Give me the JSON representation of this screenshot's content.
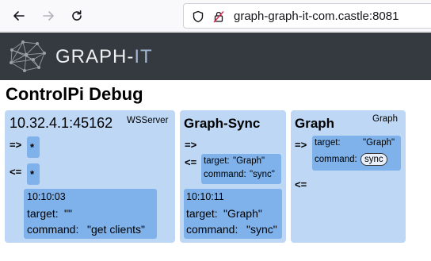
{
  "browser": {
    "url": "graph-graph-it-com.castle:8081"
  },
  "app": {
    "brand_main": "GRAPH-",
    "brand_accent": "IT"
  },
  "page": {
    "title": "ControlPi Debug"
  },
  "cards": [
    {
      "name": "10.32.4.1:45162",
      "type": "WSServer",
      "out_arrow": "=>",
      "in_arrow": "<=",
      "out_message": "*",
      "in_message": "*",
      "last_message": {
        "time": "10:10:03",
        "target_label": "target:",
        "target_value": "\"\"",
        "command_label": "command:",
        "command_value": "\"get clients\""
      }
    },
    {
      "name": "Graph-Sync",
      "out_arrow": "=>",
      "in_arrow": "<=",
      "in_message": {
        "target_label": "target:",
        "target_value": "\"Graph\"",
        "command_label": "command:",
        "command_value": "\"sync\""
      },
      "last_message": {
        "time": "10:10:11",
        "target_label": "target:",
        "target_value": "\"Graph\"",
        "command_label": "command:",
        "command_value": "\"sync\""
      }
    },
    {
      "name": "Graph",
      "type": "Graph",
      "out_arrow": "=>",
      "in_arrow": "<=",
      "out_message": {
        "target_label": "target:",
        "target_value": "\"Graph\"",
        "command_label": "command:",
        "command_value": "sync"
      }
    }
  ]
}
